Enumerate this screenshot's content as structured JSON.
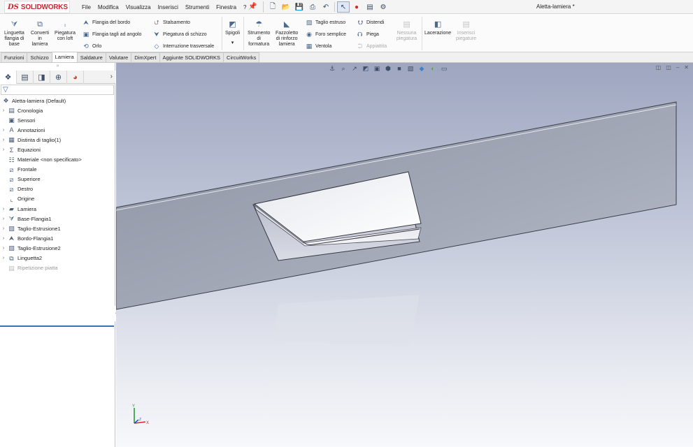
{
  "app": {
    "logo_ds": "DS",
    "logo_text": "SOLIDWORKS",
    "document_title": "Aletta-lamiera *"
  },
  "menu": [
    "File",
    "Modifica",
    "Visualizza",
    "Inserisci",
    "Strumenti",
    "Finestra",
    "?"
  ],
  "ribbon": {
    "linguetta": [
      "Linguetta",
      "flangia di",
      "base"
    ],
    "converti": [
      "Converti",
      "in",
      "lamiera"
    ],
    "piegatura_loft": [
      "Piegatura",
      "con loft"
    ],
    "col1": [
      "Flangia del bordo",
      "Flangia tagli ad angolo",
      "Orlo"
    ],
    "col2": [
      "Stalsamento",
      "Piegatura di schizzo",
      "Interruzione trasversale"
    ],
    "spigoli": "Spigoli",
    "strumento": [
      "Strumento",
      "di",
      "formatura"
    ],
    "fazzoletto": [
      "Fazzoletto",
      "di rinforzo",
      "lamiera"
    ],
    "col3": [
      "Taglio estruso",
      "Foro semplice",
      "Ventola"
    ],
    "col4": [
      "Distendi",
      "Piega",
      "Appiattita"
    ],
    "nessuna": [
      "Nessuna",
      "piegatura"
    ],
    "lacerazione": "Lacerazione",
    "inserisci": [
      "Inserisci",
      "piegature"
    ]
  },
  "tabs": [
    "Funzioni",
    "Schizzo",
    "Lamiera",
    "Saldature",
    "Valutare",
    "DimXpert",
    "Aggiunte SOLIDWORKS",
    "CircuitWorks"
  ],
  "active_tab": "Lamiera",
  "tree": {
    "root": "Aletta-lamiera  (Default)",
    "items": [
      {
        "label": "Cronologia",
        "icon": "folder-icon",
        "expandable": true
      },
      {
        "label": "Sensori",
        "icon": "sensor-icon",
        "expandable": false
      },
      {
        "label": "Annotazioni",
        "icon": "annotation-icon",
        "expandable": true
      },
      {
        "label": "Distinta di taglio(1)",
        "icon": "cut-list-icon",
        "expandable": true
      },
      {
        "label": "Equazioni",
        "icon": "equation-icon",
        "expandable": true
      },
      {
        "label": "Materiale <non specificato>",
        "icon": "material-icon",
        "expandable": false
      },
      {
        "label": "Frontale",
        "icon": "plane-icon",
        "expandable": false
      },
      {
        "label": "Superiore",
        "icon": "plane-icon",
        "expandable": false
      },
      {
        "label": "Destro",
        "icon": "plane-icon",
        "expandable": false
      },
      {
        "label": "Origine",
        "icon": "origin-icon",
        "expandable": false
      },
      {
        "label": "Lamiera",
        "icon": "sheet-metal-icon",
        "expandable": true
      },
      {
        "label": "Base-Flangia1",
        "icon": "base-flange-icon",
        "expandable": true
      },
      {
        "label": "Taglio-Estrusione1",
        "icon": "cut-extrude-icon",
        "expandable": true
      },
      {
        "label": "Bordo-Flangia1",
        "icon": "edge-flange-icon",
        "expandable": true
      },
      {
        "label": "Taglio-Estrusione2",
        "icon": "cut-extrude-icon",
        "expandable": true
      },
      {
        "label": "Linguetta2",
        "icon": "tab-feature-icon",
        "expandable": true
      },
      {
        "label": "Ripetizione piatta",
        "icon": "flat-pattern-icon",
        "expandable": false,
        "disabled": true
      }
    ]
  },
  "triad": {
    "y": "Y",
    "x": "X",
    "z": "Z"
  }
}
